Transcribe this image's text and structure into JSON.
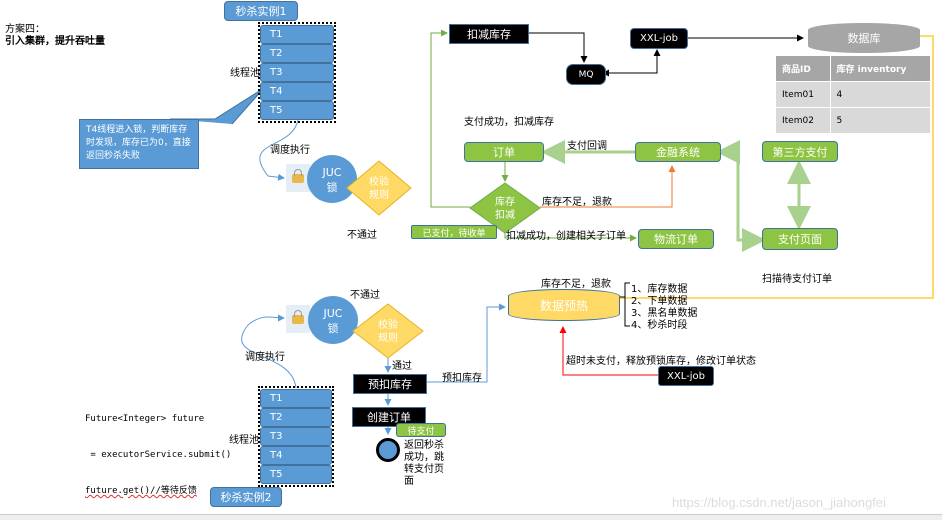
{
  "title": {
    "line1": "方案四：",
    "line2": "引入集群，提升吞吐量"
  },
  "instance1": {
    "label": "秒杀实例1",
    "pool_label": "线程池",
    "threads": [
      "T1",
      "T2",
      "T3",
      "T4",
      "T5"
    ],
    "callout": "T4线程进入锁，判断库存时发现，库存已为0，直接返回秒杀失败",
    "schedule_label": "调度执行",
    "lock_label_line1": "JUC",
    "lock_label_line2": "锁",
    "rule_line1": "校验",
    "rule_line2": "规则",
    "fail_label": "不通过"
  },
  "instance2": {
    "label": "秒杀实例2",
    "pool_label": "线程池",
    "threads": [
      "T1",
      "T2",
      "T3",
      "T4",
      "T5"
    ],
    "schedule_label": "调度执行",
    "lock_label_line1": "JUC",
    "lock_label_line2": "锁",
    "rule_line1": "校验",
    "rule_line2": "规则",
    "fail_label": "不通过",
    "pass_label": "通过",
    "pre_deduct": "预扣库存",
    "pre_deduct_edge": "预扣库存",
    "create_order": "创建订单",
    "pending_pay": "待支付",
    "return_text": [
      "返回秒杀",
      "成功，跳",
      "转支付页",
      "面"
    ],
    "code": [
      "Future<Integer> future",
      " = executorService.submit()",
      "future.get()//等待反馈"
    ]
  },
  "top_flow": {
    "deduct_stock": "扣减库存",
    "mq": "MQ",
    "xxl_job": "XXL-job",
    "database": "数据库",
    "pay_success_label": "支付成功，扣减库存",
    "order": "订单",
    "pay_callback": "支付回调",
    "finance": "金融系统",
    "third_party": "第三方支付",
    "stock_deduct_diamond_line1": "库存",
    "stock_deduct_diamond_line2": "扣减",
    "insufficient_refund": "库存不足，退款",
    "paid_pending": "已支付，待收单",
    "deduct_success": "扣减成功，创建相关子订单",
    "logistics": "物流订单",
    "pay_page": "支付页面",
    "scan_pending": "扫描待支付订单"
  },
  "db_table": {
    "headers": [
      "商品ID",
      "库存 inventory"
    ],
    "rows": [
      [
        "Item01",
        "4"
      ],
      [
        "Item02",
        "5"
      ]
    ]
  },
  "preheat": {
    "label": "数据预热",
    "top_label": "库存不足，退款",
    "items": [
      "1、库存数据",
      "2、下单数据",
      "3、黑名单数据",
      "4、秒杀时段"
    ],
    "timeout_label": "超时未支付，释放预锁库存，修改订单状态",
    "xxl_job": "XXL-job"
  },
  "watermark": "https://blog.csdn.net/jason_jiahongfei",
  "colors": {
    "blue": "#5b9bd5",
    "green": "#8dc443",
    "light_green": "#a9d18e",
    "yellow": "#ffd966",
    "orange": "#ed7d31",
    "red": "#ff0000",
    "gray": "#a6a6a6"
  }
}
